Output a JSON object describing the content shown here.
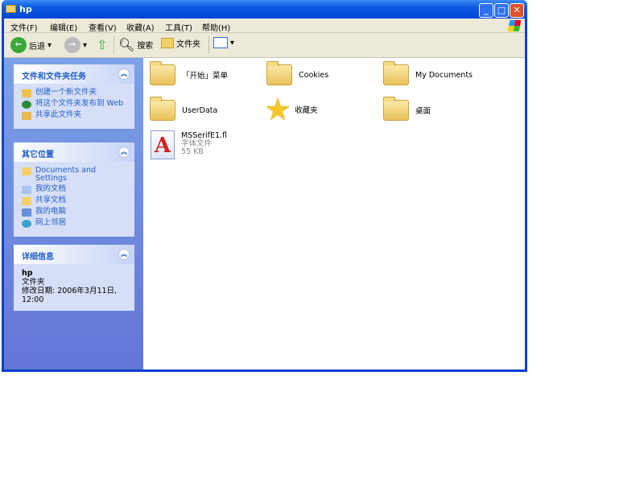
{
  "window": {
    "title": "hp"
  },
  "menu": [
    "文件(F)",
    "编辑(E)",
    "查看(V)",
    "收藏(A)",
    "工具(T)",
    "帮助(H)"
  ],
  "toolbar": {
    "back": "后退",
    "search": "搜索",
    "folders": "文件夹"
  },
  "tasks": {
    "title": "文件和文件夹任务",
    "items": [
      "创建一个新文件夹",
      "将这个文件夹发布到 Web",
      "共享此文件夹"
    ]
  },
  "places": {
    "title": "其它位置",
    "items": [
      "Documents and Settings",
      "我的文档",
      "共享文档",
      "我的电脑",
      "网上邻居"
    ]
  },
  "details": {
    "title": "详细信息",
    "name": "hp",
    "type": "文件夹",
    "modified": "修改日期: 2006年3月11日, 12:00"
  },
  "files": [
    {
      "name": "「开始」菜单",
      "icon": "folder"
    },
    {
      "name": "Cookies",
      "icon": "folder"
    },
    {
      "name": "My Documents",
      "icon": "folder"
    },
    {
      "name": "UserData",
      "icon": "folder"
    },
    {
      "name": "收藏夹",
      "icon": "star"
    },
    {
      "name": "桌面",
      "icon": "folder"
    },
    {
      "name": "MSSerifE1.fl",
      "type": "字体文件",
      "size": "55 KB",
      "icon": "font"
    }
  ]
}
